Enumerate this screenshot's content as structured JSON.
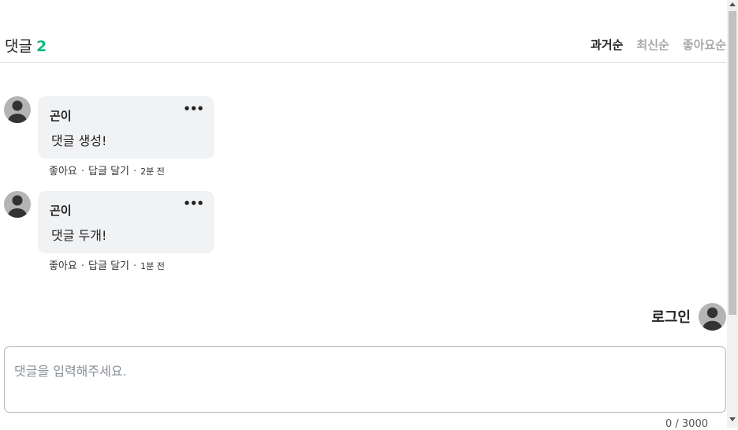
{
  "header": {
    "title": "댓글",
    "count": "2",
    "sorts": [
      {
        "label": "과거순",
        "active": true
      },
      {
        "label": "최신순",
        "active": false
      },
      {
        "label": "좋아요순",
        "active": false
      }
    ]
  },
  "comments": [
    {
      "author": "곤이",
      "text": "댓글 생성!",
      "like_label": "좋아요",
      "reply_label": "답글 달기",
      "time": "2분 전",
      "more": "•••"
    },
    {
      "author": "곤이",
      "text": "댓글 두개!",
      "like_label": "좋아요",
      "reply_label": "답글 달기",
      "time": "1분 전",
      "more": "•••"
    }
  ],
  "user": {
    "label": "로그인"
  },
  "input": {
    "placeholder": "댓글을 입력해주세요.",
    "counter": "0 / 3000"
  },
  "icons": {
    "avatar": "user-avatar-icon",
    "more": "more-horizontal-icon"
  },
  "colors": {
    "accent": "#12b886",
    "bubble": "#f1f2f4"
  }
}
